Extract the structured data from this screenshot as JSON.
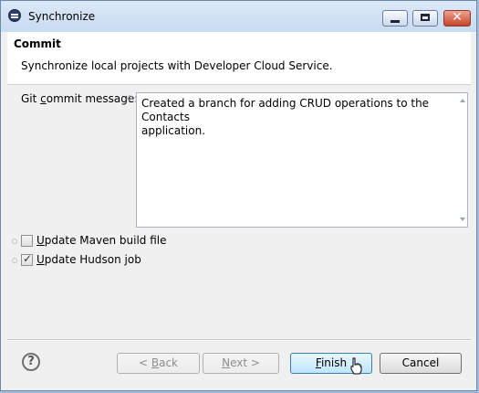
{
  "window": {
    "title": "Synchronize",
    "icon": "eclipse-icon",
    "controls": {
      "minimize": "_",
      "maximize": "□",
      "close": "✕"
    }
  },
  "header": {
    "title": "Commit",
    "description": "Synchronize local projects with Developer Cloud Service."
  },
  "form": {
    "git_label_prefix": "Git ",
    "git_label_mnemonic": "c",
    "git_label_suffix": "ommit message:",
    "commit_message": "Created a branch for adding CRUD operations to the Contacts\napplication.",
    "options": [
      {
        "mnemonic": "U",
        "label_rest": "pdate Maven build file",
        "checked": false
      },
      {
        "mnemonic": "U",
        "label_rest": "pdate Hudson job",
        "checked": true
      }
    ]
  },
  "footer": {
    "help": "?",
    "back_prefix": "< ",
    "back_mnemonic": "B",
    "back_rest": "ack",
    "next_mnemonic": "N",
    "next_rest": "ext >",
    "finish_mnemonic": "F",
    "finish_rest": "inish",
    "cancel": "Cancel"
  },
  "colors": {
    "accent": "#3c7fb1",
    "title_bar": "#dbe8f7"
  }
}
